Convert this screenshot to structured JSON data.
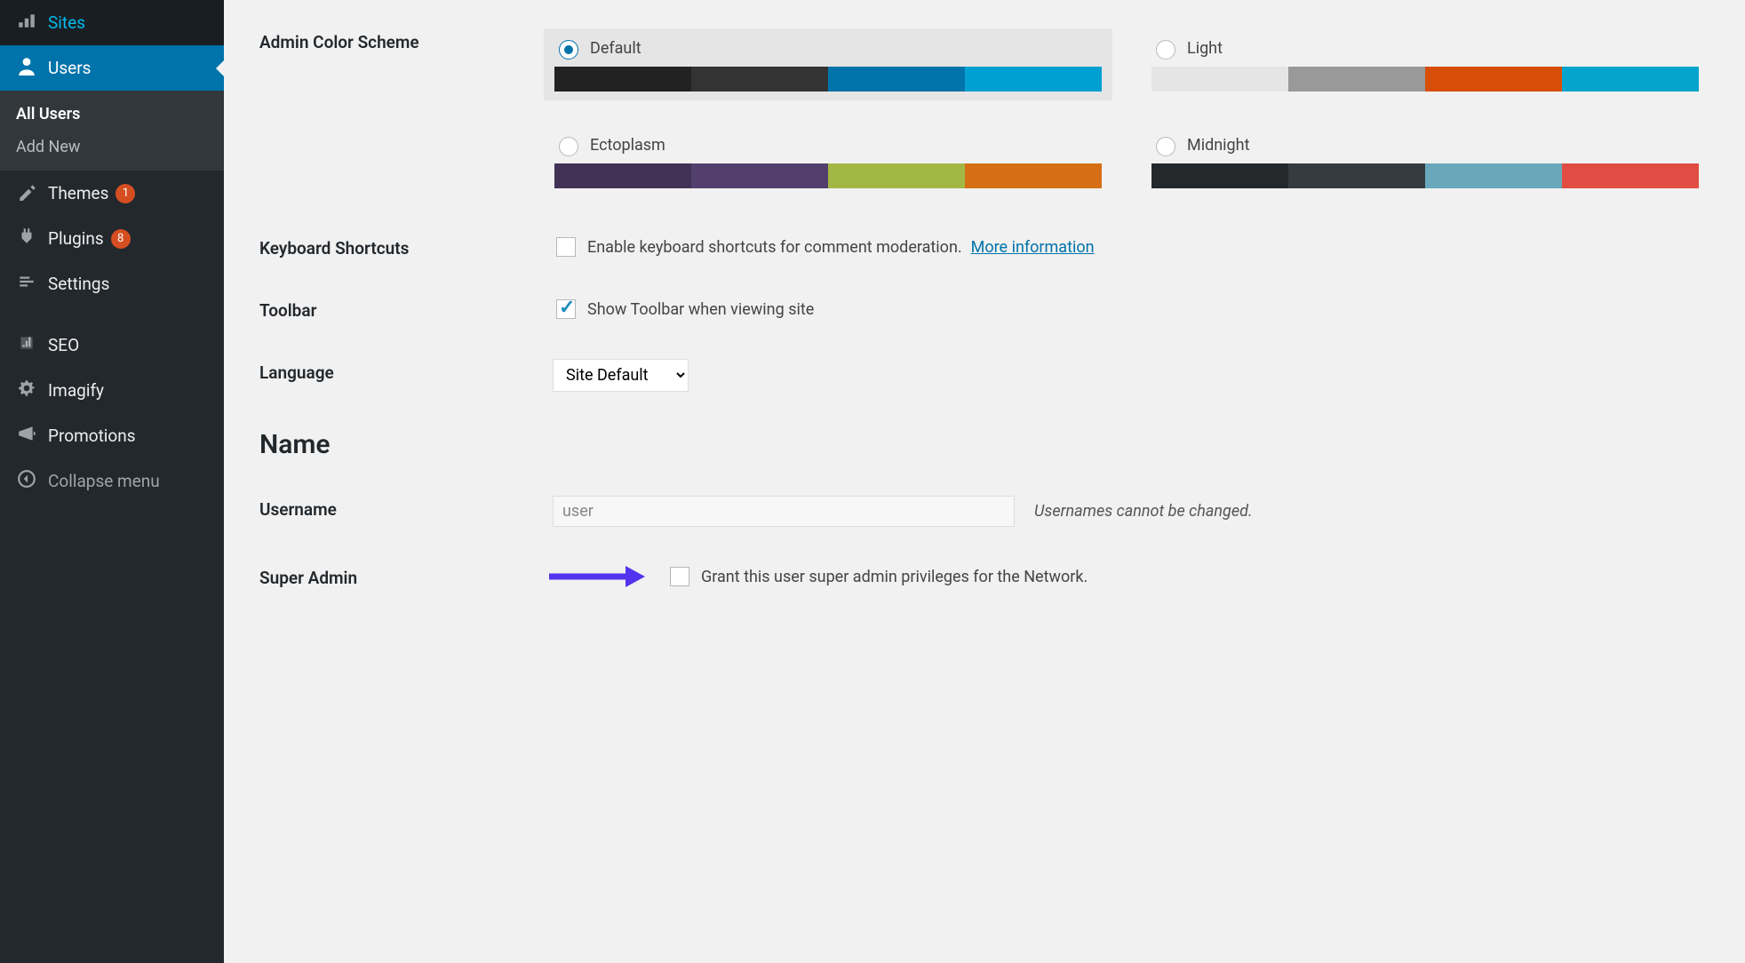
{
  "sidebar": {
    "items": [
      {
        "icon": "network",
        "label": "Sites"
      },
      {
        "icon": "user",
        "label": "Users",
        "active": true,
        "sub": [
          {
            "label": "All Users",
            "current": true
          },
          {
            "label": "Add New"
          }
        ]
      },
      {
        "icon": "brush",
        "label": "Themes",
        "badge": "1"
      },
      {
        "icon": "plug",
        "label": "Plugins",
        "badge": "8"
      },
      {
        "icon": "sliders",
        "label": "Settings"
      },
      {
        "icon": "seo",
        "label": "SEO"
      },
      {
        "icon": "gear",
        "label": "Imagify"
      },
      {
        "icon": "promo",
        "label": "Promotions"
      },
      {
        "icon": "collapse",
        "label": "Collapse menu",
        "collapse": true
      }
    ]
  },
  "form": {
    "color_scheme": {
      "label": "Admin Color Scheme",
      "options": [
        {
          "name": "Default",
          "selected": true,
          "colors": [
            "#222",
            "#333",
            "#0073aa",
            "#00a0d2"
          ]
        },
        {
          "name": "Light",
          "colors": [
            "#e5e5e5",
            "#999",
            "#d64e07",
            "#04a4cc"
          ]
        },
        {
          "name": "Ectoplasm",
          "colors": [
            "#413256",
            "#523f6d",
            "#a3b745",
            "#d46f15"
          ]
        },
        {
          "name": "Midnight",
          "colors": [
            "#25282b",
            "#363b3f",
            "#69a8bb",
            "#e14d43"
          ]
        }
      ]
    },
    "keyboard": {
      "label": "Keyboard Shortcuts",
      "opt": "Enable keyboard shortcuts for comment moderation.",
      "more": "More information"
    },
    "toolbar": {
      "label": "Toolbar",
      "opt": "Show Toolbar when viewing site",
      "checked": true
    },
    "language": {
      "label": "Language",
      "value": "Site Default"
    },
    "name_section": "Name",
    "username": {
      "label": "Username",
      "value": "user",
      "note": "Usernames cannot be changed."
    },
    "superadmin": {
      "label": "Super Admin",
      "opt": "Grant this user super admin privileges for the Network."
    }
  }
}
